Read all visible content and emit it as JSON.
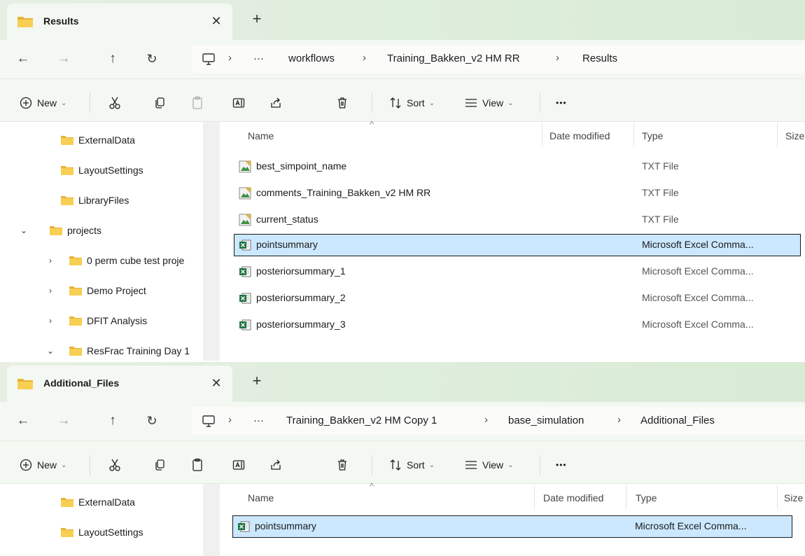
{
  "windows": [
    {
      "tab_title": "Results",
      "tab_close": "✕",
      "tab_new": "+",
      "breadcrumb": [
        "workflows",
        "Training_Bakken_v2 HM RR",
        "Results"
      ],
      "sidebar": [
        {
          "label": "ExternalData",
          "chevron": ""
        },
        {
          "label": "LayoutSettings",
          "chevron": ""
        },
        {
          "label": "LibraryFiles",
          "chevron": ""
        },
        {
          "label": "projects",
          "chevron": "expanded"
        },
        {
          "label": "0 perm cube test proje",
          "chevron": "collapsed"
        },
        {
          "label": "Demo Project",
          "chevron": "collapsed"
        },
        {
          "label": "DFIT Analysis",
          "chevron": "collapsed"
        },
        {
          "label": "ResFrac Training Day 1",
          "chevron": "expanded"
        }
      ],
      "files": [
        {
          "name": "best_simpoint_name",
          "type": "TXT File",
          "icon": "text-file-icon",
          "selected": false
        },
        {
          "name": "comments_Training_Bakken_v2 HM RR",
          "type": "TXT File",
          "icon": "text-file-icon",
          "selected": false
        },
        {
          "name": "current_status",
          "type": "TXT File",
          "icon": "text-file-icon",
          "selected": false
        },
        {
          "name": "pointsummary",
          "type": "Microsoft Excel Comma...",
          "icon": "excel-file-icon",
          "selected": true
        },
        {
          "name": "posteriorsummary_1",
          "type": "Microsoft Excel Comma...",
          "icon": "excel-file-icon",
          "selected": false
        },
        {
          "name": "posteriorsummary_2",
          "type": "Microsoft Excel Comma...",
          "icon": "excel-file-icon",
          "selected": false
        },
        {
          "name": "posteriorsummary_3",
          "type": "Microsoft Excel Comma...",
          "icon": "excel-file-icon",
          "selected": false
        }
      ]
    },
    {
      "tab_title": "Additional_Files",
      "tab_close": "✕",
      "tab_new": "+",
      "breadcrumb": [
        "Training_Bakken_v2 HM  Copy 1",
        "base_simulation",
        "Additional_Files"
      ],
      "sidebar": [
        {
          "label": "ExternalData",
          "chevron": ""
        },
        {
          "label": "LayoutSettings",
          "chevron": ""
        }
      ],
      "files": [
        {
          "name": "pointsummary",
          "type": "Microsoft Excel Comma...",
          "icon": "excel-file-icon",
          "selected": true
        }
      ]
    }
  ],
  "toolbar": {
    "new_label": "New",
    "sort_label": "Sort",
    "view_label": "View",
    "more_label": "•••",
    "ellipsis": "···",
    "sep": "›"
  },
  "columns": {
    "name": "Name",
    "date": "Date modified",
    "type": "Type",
    "size": "Size"
  },
  "colors": {
    "selection": "#cce8ff",
    "folder": "#f0c33c",
    "excel": "#1f7244",
    "underline": "#e01b1b"
  }
}
